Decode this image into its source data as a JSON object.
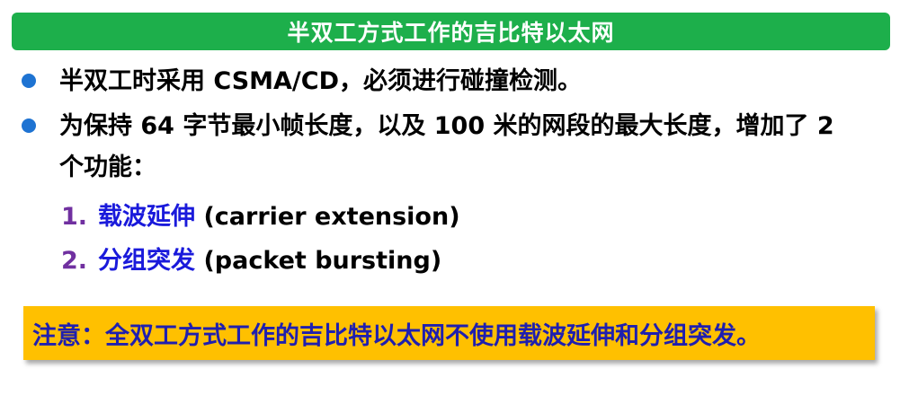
{
  "title": "半双工方式工作的吉比特以太网",
  "bullets": [
    "半双工时采用 CSMA/CD，必须进行碰撞检测。",
    "为保持 64 字节最小帧长度，以及 100 米的网段的最大长度，增加了 2 个功能："
  ],
  "sub_items": [
    {
      "num": "1.",
      "zh": "载波延伸",
      "en": "(carrier extension)"
    },
    {
      "num": "2.",
      "zh": "分组突发",
      "en": "(packet bursting)"
    }
  ],
  "note": "注意：全双工方式工作的吉比特以太网不使用载波延伸和分组突发。",
  "colors": {
    "title_bg": "#1daf4b",
    "bullet": "#1e73d2",
    "sub_number": "#7030a0",
    "sub_term": "#1a1adb",
    "note_bg": "#ffc000",
    "note_text": "#1f1faf"
  }
}
